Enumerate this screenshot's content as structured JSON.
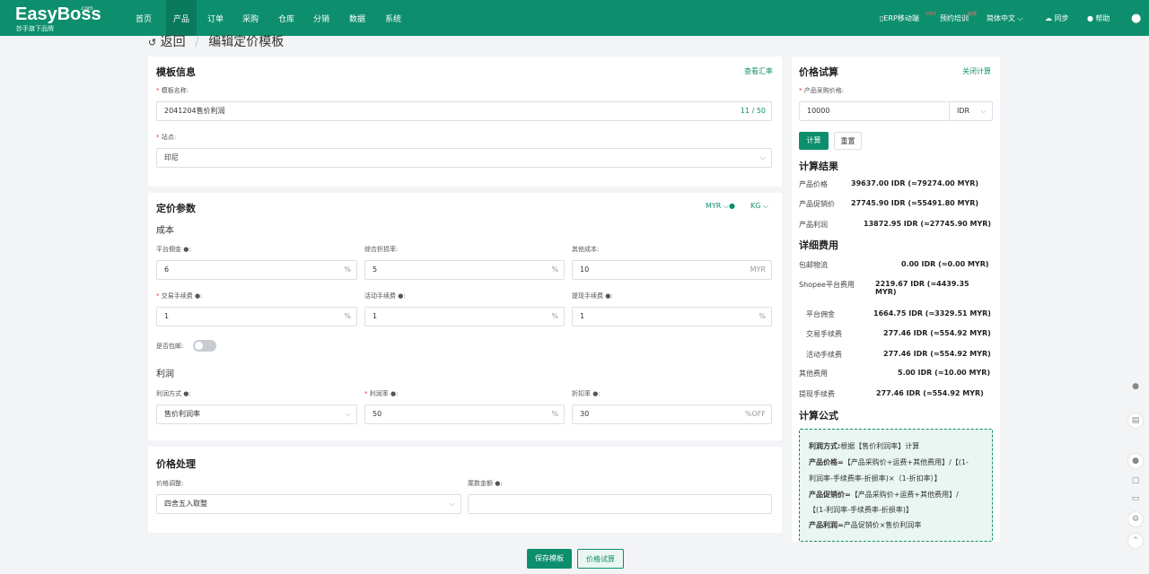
{
  "brand": {
    "name": "EasyBoss",
    "suffix": ".com",
    "tagline": "妙手旗下品牌"
  },
  "nav": [
    "首页",
    "产品",
    "订单",
    "采购",
    "仓库",
    "分销",
    "数据",
    "系统"
  ],
  "nav_active": "产品",
  "topright": {
    "erp": "ERP移动端",
    "erp_badge": "HOT",
    "training": "预约培训",
    "training_badge": "免费",
    "lang": "简体中文",
    "sync": "同步",
    "help": "帮助"
  },
  "breadcrumb": {
    "back": "返回",
    "sep": "/",
    "current": "编辑定价模板"
  },
  "template": {
    "title": "模板信息",
    "rate_link": "查看汇率",
    "name_label": "模板名称:",
    "name_value": "2041204售价利润",
    "name_count": "11 / 50",
    "site_label": "站点:",
    "site_value": "印尼"
  },
  "pricing": {
    "title": "定价参数",
    "currency": "MYR",
    "weight": "KG",
    "cost_heading": "成本",
    "platform_fee_label": "平台佣金",
    "platform_fee": "6",
    "platform_fee_unit": "%",
    "discount_loss_label": "综合折损率:",
    "discount_loss": "5",
    "discount_loss_unit": "%",
    "other_cost_label": "其他成本:",
    "other_cost": "10",
    "other_cost_unit": "MYR",
    "txn_fee_label": "交易手续费",
    "txn_fee": "1",
    "txn_fee_unit": "%",
    "activity_fee_label": "活动手续费",
    "activity_fee": "1",
    "activity_fee_unit": "%",
    "withdraw_fee_label": "提现手续费",
    "withdraw_fee": "1",
    "withdraw_fee_unit": "%",
    "free_ship_label": "是否包邮:",
    "profit_heading": "利润",
    "profit_method_label": "利润方式",
    "profit_method": "售价利润率",
    "profit_rate_label": "利润率",
    "profit_rate": "50",
    "profit_rate_unit": "%",
    "discount_label": "折扣率",
    "discount": "30",
    "discount_unit": "%OFF"
  },
  "price_proc": {
    "title": "价格处理",
    "adjust_label": "价格调整:",
    "adjust_value": "四舍五入取整",
    "tail_label": "尾数金额"
  },
  "calc": {
    "title": "价格试算",
    "close": "关闭计算",
    "cost_label": "产品采购价格:",
    "cost_value": "10000",
    "cost_currency": "IDR",
    "btn_calc": "计算",
    "btn_reset": "重置",
    "result_title": "计算结果",
    "results": [
      {
        "label": "产品价格",
        "value": "39637.00 IDR (≈79274.00 MYR)"
      },
      {
        "label": "产品促销价",
        "value": "27745.90 IDR (≈55491.80 MYR)"
      },
      {
        "label": "产品利润",
        "value": "13872.95 IDR (≈27745.90 MYR)"
      }
    ],
    "fee_title": "详细费用",
    "fees": [
      {
        "label": "包邮物流",
        "value": "0.00 IDR (≈0.00 MYR)"
      },
      {
        "label": "Shopee平台费用",
        "value": "2219.67 IDR (≈4439.35",
        "value2": "MYR)"
      },
      {
        "label": "平台佣金",
        "value": "1664.75 IDR (≈3329.51 MYR)"
      },
      {
        "label": "交易手续费",
        "value": "277.46 IDR (≈554.92 MYR)"
      },
      {
        "label": "活动手续费",
        "value": "277.46 IDR (≈554.92 MYR)"
      },
      {
        "label": "其他费用",
        "value": "5.00 IDR (≈10.00 MYR)"
      },
      {
        "label": "提现手续费",
        "value": "277.46 IDR (≈554.92 MYR)"
      }
    ],
    "formula_title": "计算公式",
    "formula": [
      {
        "b": "利润方式:",
        "t": "根据【售价利润率】计算"
      },
      {
        "b": "产品价格=",
        "t": "【产品采购价+运费+其他费用】/【(1-"
      },
      {
        "b": "",
        "t": "利润率-手续费率-折损率)×（1-折扣率）】"
      },
      {
        "b": "产品促销价=",
        "t": "【产品采购价+运费+其他费用】/"
      },
      {
        "b": "",
        "t": "【(1-利润率-手续费率-折损率)】"
      },
      {
        "b": "产品利润=",
        "t": "产品促销价×售价利润率"
      }
    ]
  },
  "footer": {
    "save": "保存模板",
    "trial": "价格试算"
  },
  "colors": {
    "brand": "#0d8f6d",
    "nav_active": "#0a7a5c",
    "formula_bg": "#e9f6f1"
  }
}
